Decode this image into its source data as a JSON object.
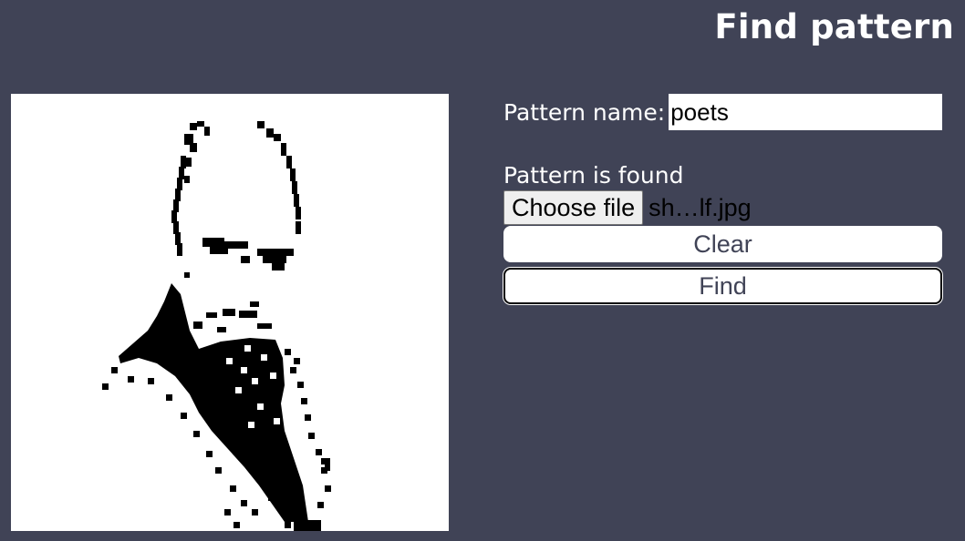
{
  "page": {
    "title": "Find pattern"
  },
  "form": {
    "name_label": "Pattern name:",
    "name_value": "poets",
    "status_text": "Pattern is found",
    "file_button_label": "Choose file",
    "file_name": "sh…lf.jpg",
    "clear_label": "Clear",
    "find_label": "Find"
  },
  "colors": {
    "background": "#404356",
    "button_text": "#404356",
    "canvas": "#ffffff",
    "pixel": "#000000"
  },
  "icons": {
    "pattern_image": "bitmap-portrait-bearded-man"
  }
}
